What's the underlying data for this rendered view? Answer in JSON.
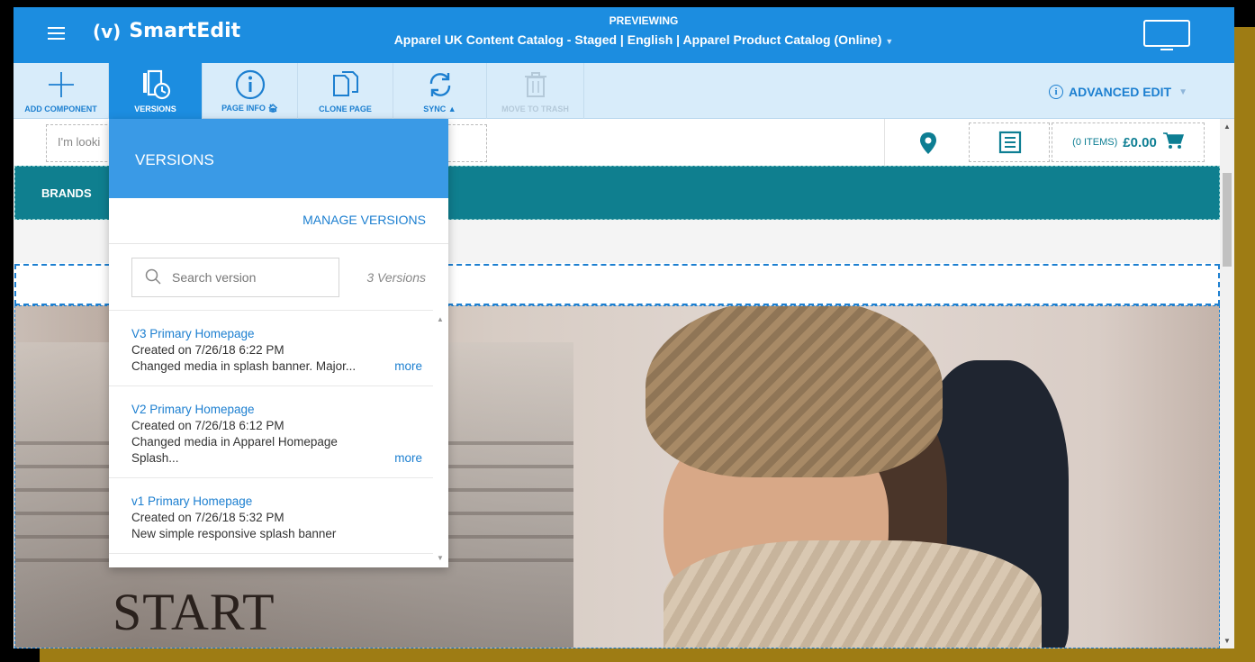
{
  "header": {
    "app_name": "SmartEdit",
    "logo_mark": "(v)",
    "preview_label": "PREVIEWING",
    "preview_title": "Apparel UK Content Catalog - Staged | English | Apparel Product Catalog (Online)"
  },
  "toolbar": {
    "items": [
      {
        "label": "ADD COMPONENT",
        "icon": "plus-icon"
      },
      {
        "label": "VERSIONS",
        "icon": "versions-icon"
      },
      {
        "label": "PAGE INFO",
        "icon": "info-icon"
      },
      {
        "label": "CLONE PAGE",
        "icon": "clone-icon"
      },
      {
        "label": "SYNC",
        "icon": "sync-icon"
      },
      {
        "label": "MOVE TO TRASH",
        "icon": "trash-icon"
      }
    ],
    "advanced_edit": "ADVANCED EDIT"
  },
  "site": {
    "search_placeholder": "I'm looki",
    "cart_items": "(0 ITEMS)",
    "cart_total": "£0.00",
    "nav_brands": "BRANDS",
    "hero_text": "START"
  },
  "versions": {
    "title": "VERSIONS",
    "manage_label": "MANAGE VERSIONS",
    "search_placeholder": "Search version",
    "count": "3 Versions",
    "items": [
      {
        "name": "V3 Primary Homepage",
        "created": "Created on 7/26/18 6:22 PM",
        "desc": "Changed media in splash banner. Major...",
        "more": "more"
      },
      {
        "name": "V2 Primary Homepage",
        "created": "Created on 7/26/18 6:12 PM",
        "desc": "Changed media in Apparel Homepage Splash...",
        "more": "more"
      },
      {
        "name": "v1 Primary Homepage",
        "created": "Created on 7/26/18 5:32 PM",
        "desc": "New simple responsive splash banner",
        "more": ""
      }
    ]
  },
  "colors": {
    "header_blue": "#1c8de0",
    "toolbar_bg": "#d8ecfa",
    "nav_teal": "#0f7f8f",
    "frame_gold": "#9e7c14"
  }
}
